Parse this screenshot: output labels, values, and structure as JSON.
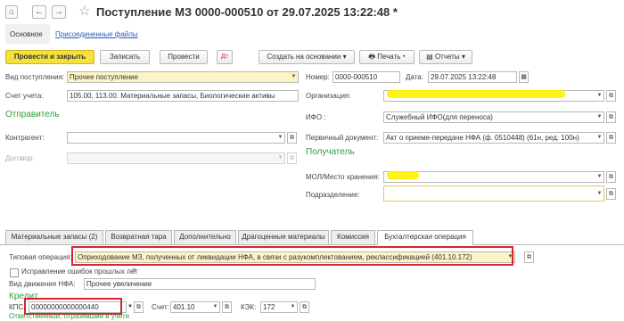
{
  "window": {
    "title": "Поступление МЗ 0000-000510 от 29.07.2025 13:22:48 *",
    "home_icon": "⌂",
    "back_icon": "←",
    "forward_icon": "→",
    "star_icon": "☆"
  },
  "subtabs": {
    "main": "Основное",
    "files": "Присоединенные файлы"
  },
  "toolbar": {
    "post_close": "Провести и закрыть",
    "save": "Записать",
    "post": "Провести",
    "create_based": "Создать на основании",
    "print": "Печать",
    "reports": "Отчеты"
  },
  "form": {
    "vid_label": "Вид поступления:",
    "vid_value": "Прочее поступление",
    "nomer_label": "Номер:",
    "nomer_value": "0000-000510",
    "data_label": "Дата:",
    "data_value": "29.07.2025 13:22:48",
    "schet_label": "Счет учета:",
    "schet_value": "105.00, 113.00. Материальные запасы, Биологические активы",
    "org_label": "Организация:",
    "sender_heading": "Отправитель",
    "ifo_label": "ИФО :",
    "ifo_value": "Служебный ИФО(для переноса)",
    "kontragent_label": "Контрагент:",
    "perv_doc_label": "Первичный документ:",
    "perv_doc_value": "Акт о приеме-передаче НФА (ф. 0510448) (61н, ред. 100н)",
    "dogovor_label": "Договор:",
    "receiver_heading": "Получатель",
    "mol_label": "МОЛ/Место хранения:",
    "podrazd_label": "Подразделение:"
  },
  "tabs": [
    "Материальные запасы (2)",
    "Возвратная тара",
    "Дополнительно",
    "Драгоценные материалы",
    "Комиссия",
    "Бухгалтерская операция"
  ],
  "operation": {
    "tipovaya_label": "Типовая операция:",
    "tipovaya_value": "Оприходование МЗ, полученных от ликвидации НФА, в связи с разукомплектованием, реклассификацией (401.10.172)",
    "correction_label": "Исправление ошибок прошлых лет",
    "help_mark": "?",
    "dvizh_label": "Вид движения НФА:",
    "dvizh_value": "Прочее увеличение",
    "credit_heading": "Кредит",
    "kps_label": "КПС:",
    "kps_value": "00000000000000440",
    "schet_label": "Счет:",
    "schet_value": "401.10",
    "kek_label": "КЭК:",
    "kek_value": "172",
    "responsible_heading": "Ответственный, отразивший в учете"
  }
}
